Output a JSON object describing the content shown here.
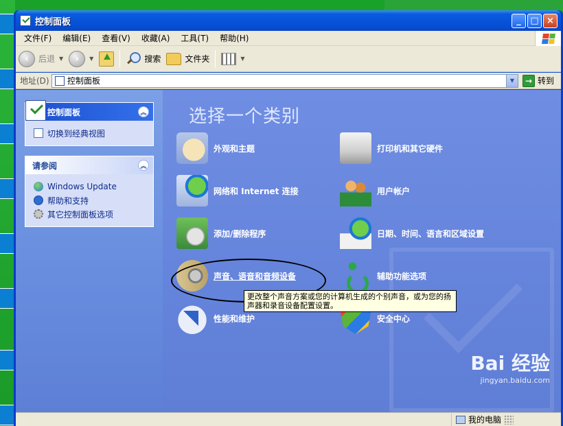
{
  "window": {
    "title": "控制面板",
    "buttons": {
      "minimize": "_",
      "maximize": "□",
      "close": "×"
    }
  },
  "menu": {
    "items": [
      "文件(F)",
      "编辑(E)",
      "查看(V)",
      "收藏(A)",
      "工具(T)",
      "帮助(H)"
    ]
  },
  "toolbar": {
    "back": "后退",
    "search": "搜索",
    "folders": "文件夹"
  },
  "address": {
    "label": "地址(D)",
    "value": "控制面板",
    "go": "转到"
  },
  "sidebar": {
    "control_panel": {
      "title": "控制面板",
      "switch_view": "切换到经典视图"
    },
    "see_also": {
      "title": "请参阅",
      "links": [
        "Windows Update",
        "帮助和支持",
        "其它控制面板选项"
      ]
    }
  },
  "main": {
    "heading": "选择一个类别",
    "categories": [
      {
        "label": "外观和主题",
        "icon": "appearance-icon"
      },
      {
        "label": "打印机和其它硬件",
        "icon": "printer-icon"
      },
      {
        "label": "网络和 Internet 连接",
        "icon": "network-icon"
      },
      {
        "label": "用户帐户",
        "icon": "user-accounts-icon"
      },
      {
        "label": "添加/删除程序",
        "icon": "add-remove-icon"
      },
      {
        "label": "日期、时间、语言和区域设置",
        "icon": "date-time-icon"
      },
      {
        "label": "声音、语音和音频设备",
        "icon": "sound-icon"
      },
      {
        "label": "辅助功能选项",
        "icon": "accessibility-icon"
      },
      {
        "label": "性能和维护",
        "icon": "performance-icon"
      },
      {
        "label": "安全中心",
        "icon": "security-center-icon"
      }
    ],
    "tooltip": "更改整个声音方案或您的计算机生成的个别声音，或为您的扬声器和录音设备配置设置。"
  },
  "status": {
    "zone": "我的电脑"
  },
  "watermark": {
    "brand": "Bai 经验",
    "url": "jingyan.baidu.com"
  },
  "colors": {
    "titlebar": "#0552d8",
    "sidebar": "#7ba0e6",
    "main": "#6f8ee3",
    "chrome": "#ece9d8",
    "tooltip": "#ffffe1"
  }
}
